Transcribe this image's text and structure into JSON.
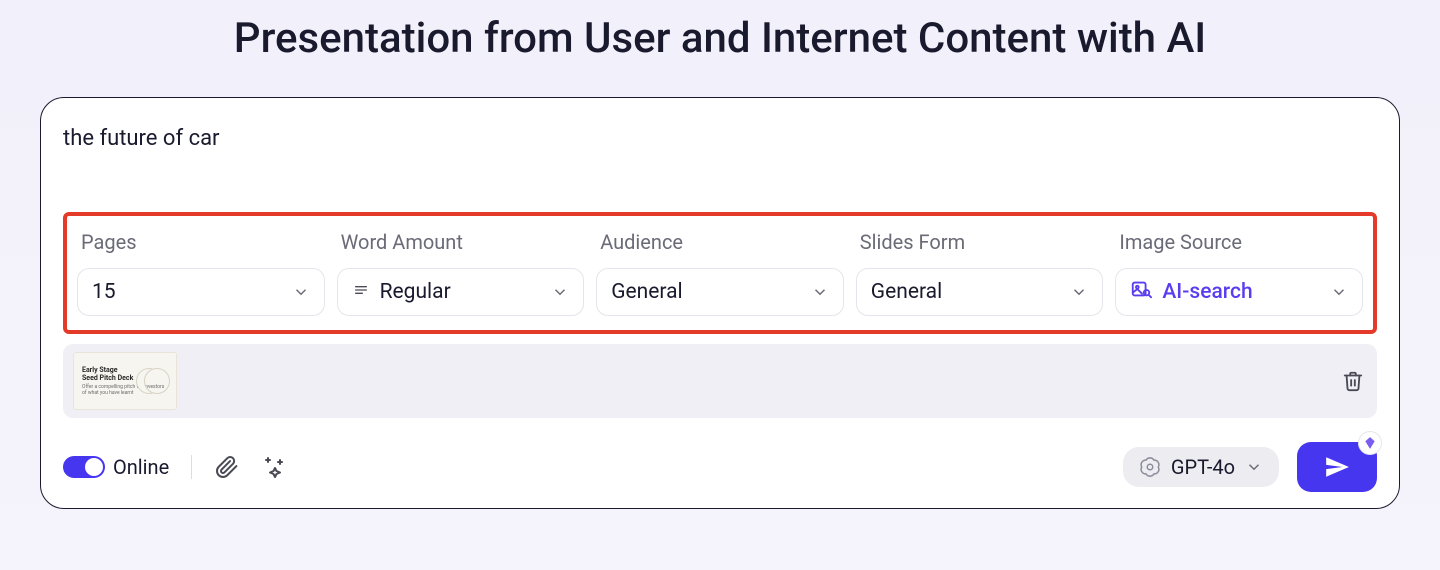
{
  "page_title": "Presentation from User and Internet Content with AI",
  "prompt_text": "the future of car",
  "settings": {
    "pages": {
      "label": "Pages",
      "value": "15"
    },
    "word_amount": {
      "label": "Word Amount",
      "value": "Regular"
    },
    "audience": {
      "label": "Audience",
      "value": "General"
    },
    "slides_form": {
      "label": "Slides Form",
      "value": "General"
    },
    "image_source": {
      "label": "Image Source",
      "value": "AI-search"
    }
  },
  "attachment": {
    "thumb_line1": "Early Stage",
    "thumb_line2": "Seed Pitch Deck",
    "thumb_sub": "Offer a compelling pitch for investors of what you have learnt"
  },
  "footer": {
    "online_label": "Online",
    "model_label": "GPT-4o"
  }
}
